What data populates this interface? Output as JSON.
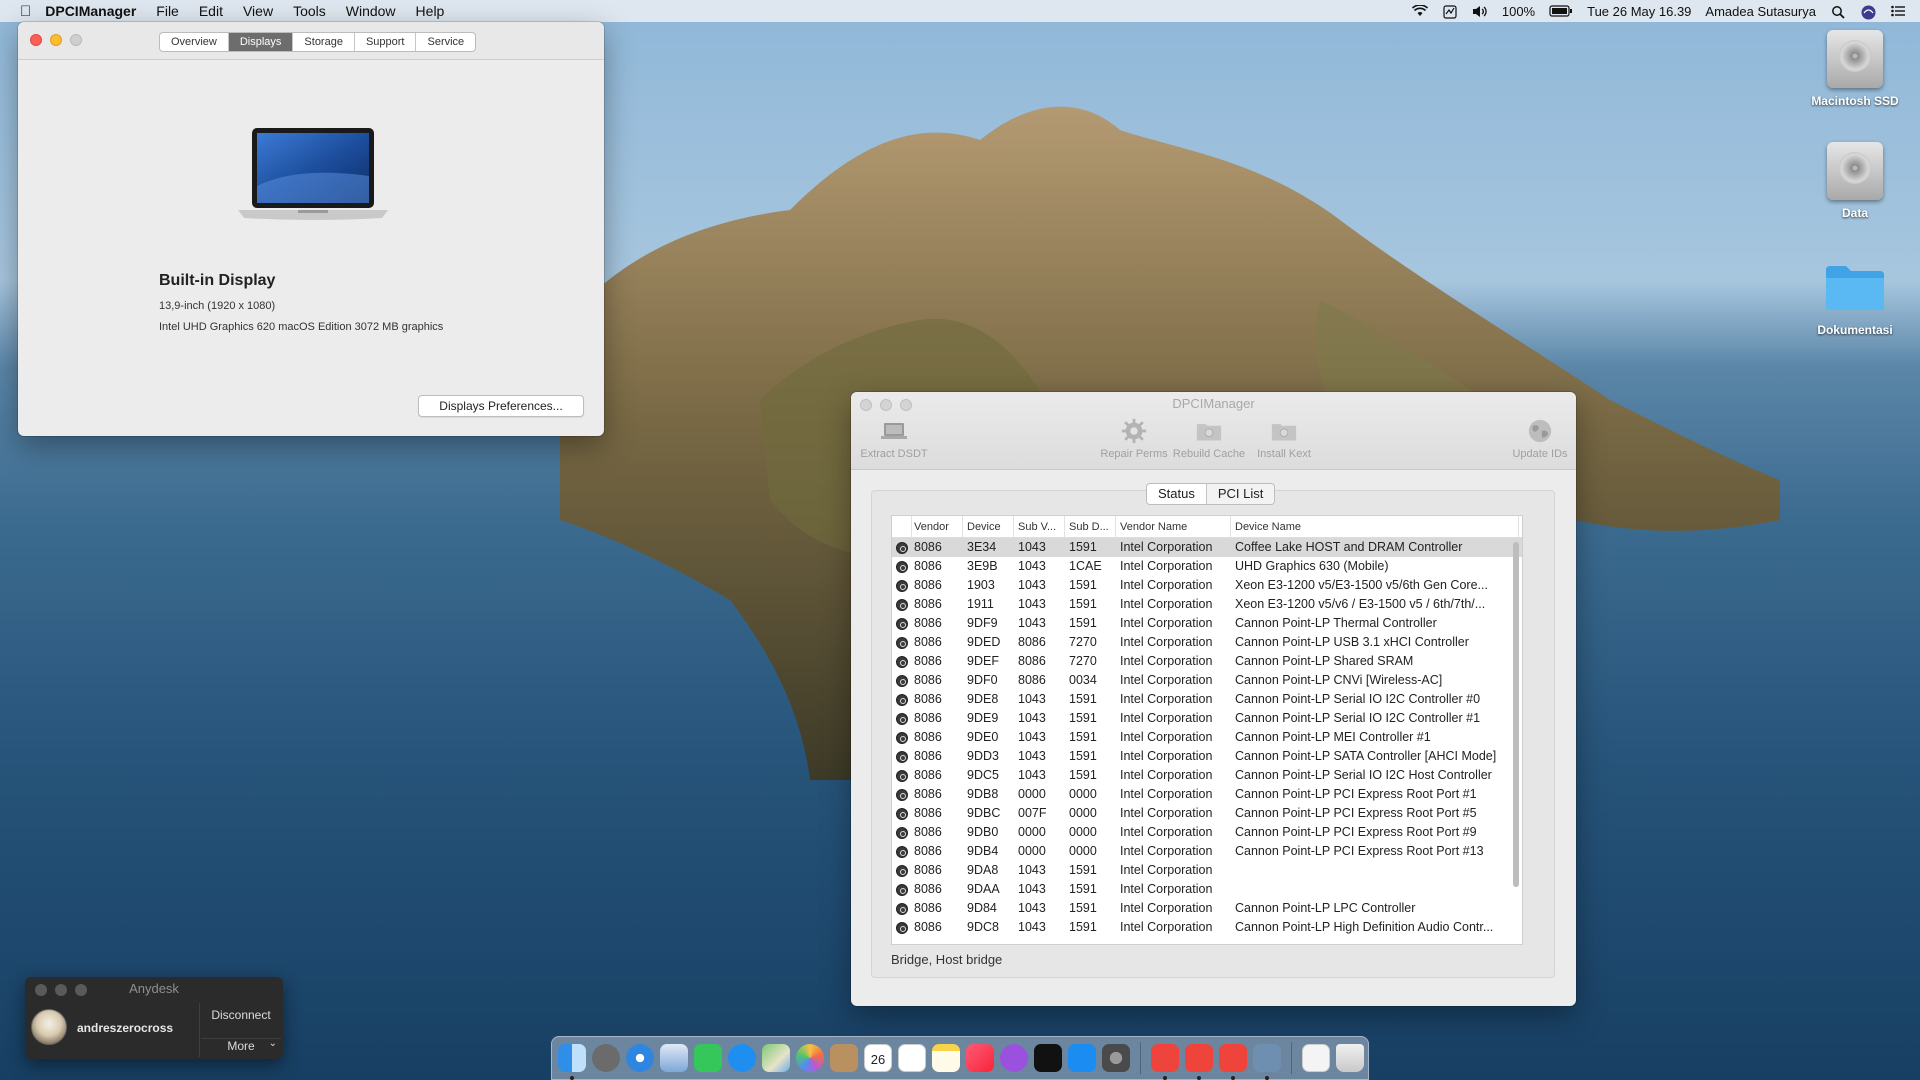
{
  "menubar": {
    "app_name": "DPCIManager",
    "menus": [
      "File",
      "Edit",
      "View",
      "Tools",
      "Window",
      "Help"
    ],
    "battery": "100%",
    "datetime": "Tue 26 May  16.39",
    "user": "Amadea Sutasurya",
    "icons": [
      "apple-icon",
      "wifi-icon",
      "activity-icon",
      "volume-icon",
      "battery-icon",
      "spotlight-icon",
      "siri-icon",
      "notification-center-icon"
    ]
  },
  "about": {
    "tabs": [
      "Overview",
      "Displays",
      "Storage",
      "Support",
      "Service"
    ],
    "active_tab": "Displays",
    "display_name": "Built-in Display",
    "size_line": "13,9-inch (1920 x 1080)",
    "graphics_line": "Intel UHD Graphics 620 macOS Edition 3072 MB graphics",
    "button": "Displays Preferences..."
  },
  "desktop": {
    "icons": [
      {
        "label": "Macintosh SSD",
        "type": "drive"
      },
      {
        "label": "Data",
        "type": "drive"
      },
      {
        "label": "Dokumentasi",
        "type": "folder"
      }
    ]
  },
  "dpci": {
    "title": "DPCIManager",
    "toolbar": [
      "Extract DSDT",
      "Repair Perms",
      "Rebuild Cache",
      "Install Kext",
      "Update IDs"
    ],
    "tabs": [
      "Status",
      "PCI List"
    ],
    "active_tab": "PCI List",
    "columns": [
      "Vendor",
      "Device",
      "Sub V...",
      "Sub D...",
      "Vendor Name",
      "Device Name"
    ],
    "rows": [
      [
        "8086",
        "3E34",
        "1043",
        "1591",
        "Intel Corporation",
        "Coffee Lake HOST and DRAM Controller"
      ],
      [
        "8086",
        "3E9B",
        "1043",
        "1CAE",
        "Intel Corporation",
        "UHD Graphics 630 (Mobile)"
      ],
      [
        "8086",
        "1903",
        "1043",
        "1591",
        "Intel Corporation",
        "Xeon E3-1200 v5/E3-1500 v5/6th Gen Core..."
      ],
      [
        "8086",
        "1911",
        "1043",
        "1591",
        "Intel Corporation",
        "Xeon E3-1200 v5/v6 / E3-1500 v5 / 6th/7th/..."
      ],
      [
        "8086",
        "9DF9",
        "1043",
        "1591",
        "Intel Corporation",
        "Cannon Point-LP Thermal Controller"
      ],
      [
        "8086",
        "9DED",
        "8086",
        "7270",
        "Intel Corporation",
        "Cannon Point-LP USB 3.1 xHCI Controller"
      ],
      [
        "8086",
        "9DEF",
        "8086",
        "7270",
        "Intel Corporation",
        "Cannon Point-LP Shared SRAM"
      ],
      [
        "8086",
        "9DF0",
        "8086",
        "0034",
        "Intel Corporation",
        "Cannon Point-LP CNVi [Wireless-AC]"
      ],
      [
        "8086",
        "9DE8",
        "1043",
        "1591",
        "Intel Corporation",
        "Cannon Point-LP Serial IO I2C Controller #0"
      ],
      [
        "8086",
        "9DE9",
        "1043",
        "1591",
        "Intel Corporation",
        "Cannon Point-LP Serial IO I2C Controller #1"
      ],
      [
        "8086",
        "9DE0",
        "1043",
        "1591",
        "Intel Corporation",
        "Cannon Point-LP MEI Controller #1"
      ],
      [
        "8086",
        "9DD3",
        "1043",
        "1591",
        "Intel Corporation",
        "Cannon Point-LP SATA Controller [AHCI Mode]"
      ],
      [
        "8086",
        "9DC5",
        "1043",
        "1591",
        "Intel Corporation",
        "Cannon Point-LP Serial IO I2C Host Controller"
      ],
      [
        "8086",
        "9DB8",
        "0000",
        "0000",
        "Intel Corporation",
        "Cannon Point-LP PCI Express Root Port #1"
      ],
      [
        "8086",
        "9DBC",
        "007F",
        "0000",
        "Intel Corporation",
        "Cannon Point-LP PCI Express Root Port #5"
      ],
      [
        "8086",
        "9DB0",
        "0000",
        "0000",
        "Intel Corporation",
        "Cannon Point-LP PCI Express Root Port #9"
      ],
      [
        "8086",
        "9DB4",
        "0000",
        "0000",
        "Intel Corporation",
        "Cannon Point-LP PCI Express Root Port #13"
      ],
      [
        "8086",
        "9DA8",
        "1043",
        "1591",
        "Intel Corporation",
        ""
      ],
      [
        "8086",
        "9DAA",
        "1043",
        "1591",
        "Intel Corporation",
        ""
      ],
      [
        "8086",
        "9D84",
        "1043",
        "1591",
        "Intel Corporation",
        "Cannon Point-LP LPC Controller"
      ],
      [
        "8086",
        "9DC8",
        "1043",
        "1591",
        "Intel Corporation",
        "Cannon Point-LP High Definition Audio Contr..."
      ]
    ],
    "status_text": "Bridge, Host bridge"
  },
  "anydesk": {
    "title": "Anydesk",
    "user": "andreszerocross",
    "disconnect": "Disconnect",
    "more": "More"
  },
  "dock": {
    "apps": [
      "finder-icon",
      "launchpad-icon",
      "safari-icon",
      "preview-icon",
      "facetime-icon",
      "messages-icon",
      "maps-icon",
      "photos-icon",
      "contacts-icon",
      "calendar-icon",
      "reminders-icon",
      "notes-icon",
      "music-icon",
      "podcasts-icon",
      "tv-icon",
      "app-store-icon",
      "system-preferences-icon",
      "anydesk-icon",
      "anydesk-icon-2",
      "anydesk-icon-3",
      "network-utility-icon",
      "documents-icon",
      "trash-icon"
    ],
    "calendar_day": "26"
  },
  "colors": {
    "close": "#fc5f57",
    "minimize": "#fdbc2e",
    "zoom": "#cfcfcf",
    "selection": "#d9d9d9"
  }
}
